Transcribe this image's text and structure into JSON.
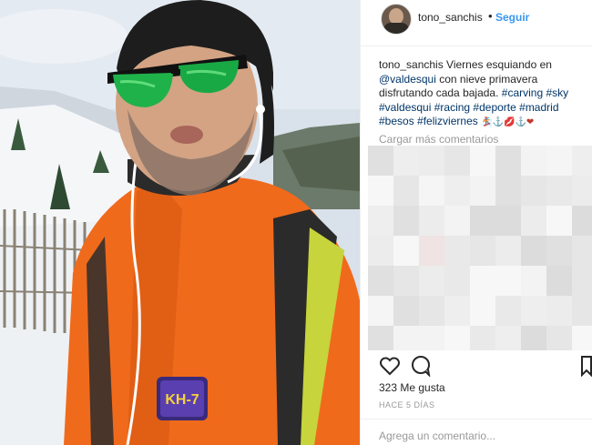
{
  "post": {
    "username": "tono_sanchis",
    "separator": "•",
    "follow_label": "Seguir",
    "photo_badge": "KH-7",
    "caption": {
      "user": "tono_sanchis",
      "text1": " Viernes esquiando en ",
      "mention": "@valdesqui",
      "text2": " con nieve primavera disfrutando cada bajada. ",
      "tags": [
        "#carving",
        "#sky",
        "#valdesqui",
        "#racing",
        "#deporte",
        "#madrid",
        "#besos",
        "#felizviernes"
      ],
      "emojis": "🏂⚓💋⚓❤"
    },
    "load_more": "Cargar más comentarios",
    "likes": "323 Me gusta",
    "time": "HACE 5 DÍAS",
    "comment_placeholder": "Agrega un comentario..."
  },
  "colors": {
    "link": "#3897f0",
    "hashtag": "#003569",
    "jacket": "#f06a1c"
  },
  "icons": [
    "heart-icon",
    "comment-icon",
    "bookmark-icon"
  ]
}
